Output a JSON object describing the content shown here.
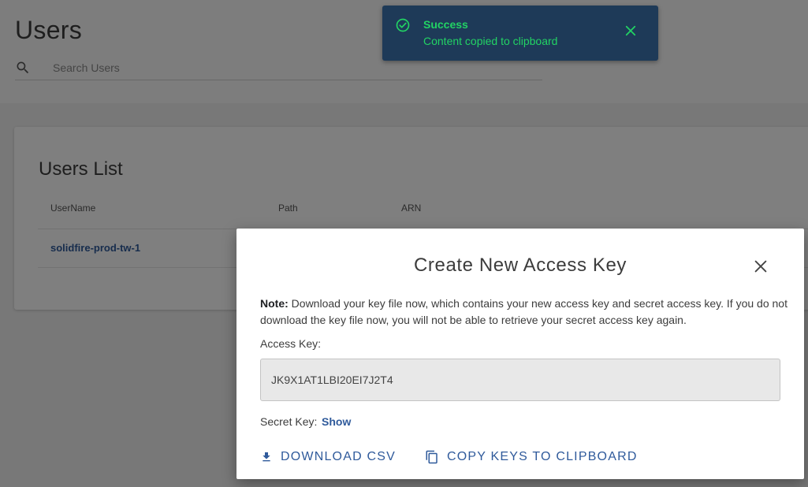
{
  "page": {
    "title": "Users",
    "search_placeholder": "Search Users"
  },
  "users_list": {
    "title": "Users List",
    "columns": [
      "UserName",
      "Path",
      "ARN"
    ],
    "rows": [
      {
        "username": "solidfire-prod-tw-1"
      }
    ]
  },
  "toast": {
    "title": "Success",
    "message": "Content copied to clipboard",
    "color": "#22d364",
    "background": "#1e3a58",
    "icon": "check-circle-icon"
  },
  "modal": {
    "title": "Create New Access Key",
    "note_label": "Note:",
    "note_text": " Download your key file now, which contains your new access key and secret access key. If you do not download the key file now, you will not be able to retrieve your secret access key again.",
    "access_key_label": "Access Key:",
    "access_key_value": "JK9X1AT1LBI20EI7J2T4",
    "secret_key_label": "Secret Key:",
    "secret_key_action": "Show",
    "download_label": "DOWNLOAD CSV",
    "copy_label": "COPY KEYS TO CLIPBOARD",
    "accent_color": "#2f5a9b"
  }
}
